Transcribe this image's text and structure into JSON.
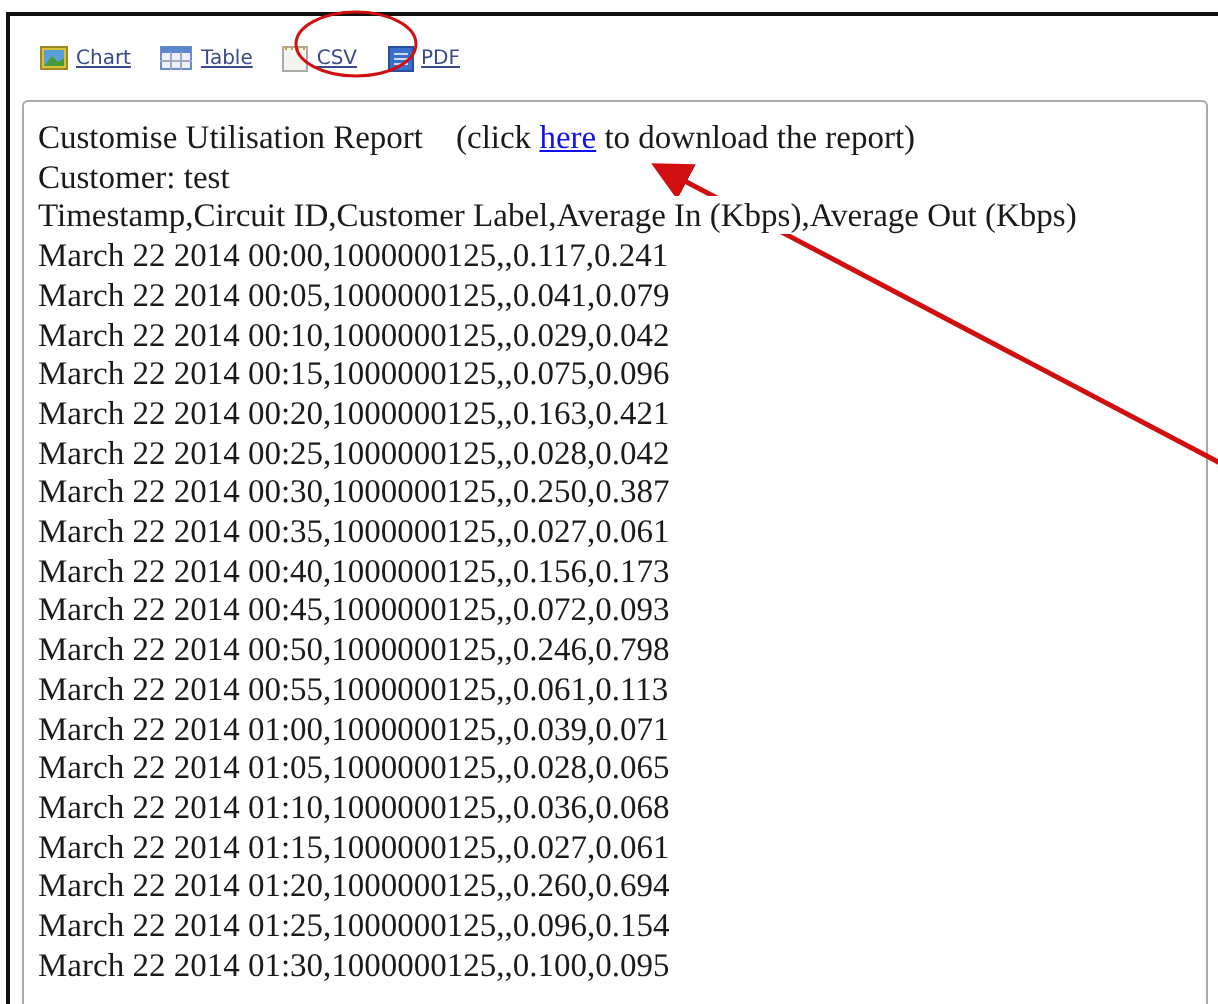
{
  "toolbar": [
    {
      "kind": "chart",
      "label": "Chart"
    },
    {
      "kind": "table",
      "label": "Table"
    },
    {
      "kind": "csv",
      "label": "CSV"
    },
    {
      "kind": "pdf",
      "label": "PDF"
    }
  ],
  "report": {
    "title": "Customise Utilisation Report",
    "note_before": "(click",
    "link": "here",
    "note_after": "to download the report)",
    "customer": "Customer: test",
    "header": "Timestamp,Circuit ID,Customer Label,Average In (Kbps),Average Out (Kbps)",
    "rows": [
      "March 22 2014 00:00,1000000125,,0.117,0.241",
      "March 22 2014 00:05,1000000125,,0.041,0.079",
      "March 22 2014 00:10,1000000125,,0.029,0.042",
      "March 22 2014 00:15,1000000125,,0.075,0.096",
      "March 22 2014 00:20,1000000125,,0.163,0.421",
      "March 22 2014 00:25,1000000125,,0.028,0.042",
      "March 22 2014 00:30,1000000125,,0.250,0.387",
      "March 22 2014 00:35,1000000125,,0.027,0.061",
      "March 22 2014 00:40,1000000125,,0.156,0.173",
      "March 22 2014 00:45,1000000125,,0.072,0.093",
      "March 22 2014 00:50,1000000125,,0.246,0.798",
      "March 22 2014 00:55,1000000125,,0.061,0.113",
      "March 22 2014 01:00,1000000125,,0.039,0.071",
      "March 22 2014 01:05,1000000125,,0.028,0.065",
      "March 22 2014 01:10,1000000125,,0.036,0.068",
      "March 22 2014 01:15,1000000125,,0.027,0.061",
      "March 22 2014 01:20,1000000125,,0.260,0.694",
      "March 22 2014 01:25,1000000125,,0.096,0.154",
      "March 22 2014 01:30,1000000125,,0.100,0.095"
    ]
  }
}
